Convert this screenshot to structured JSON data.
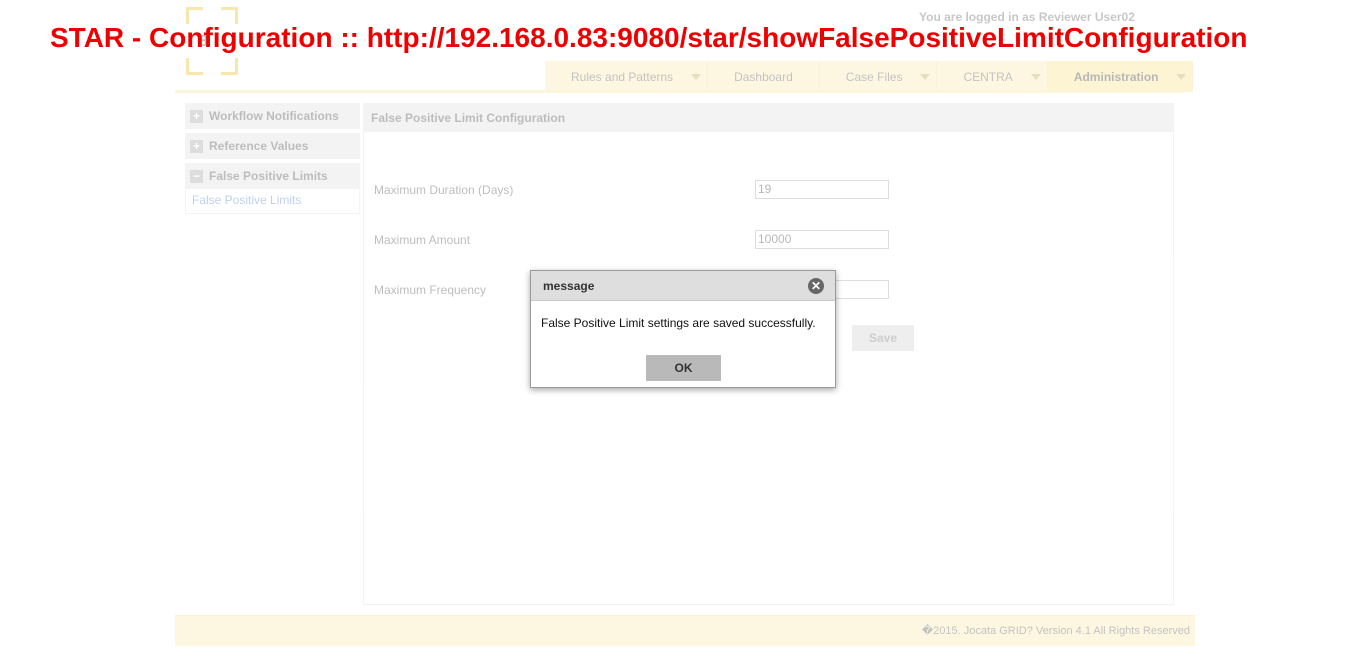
{
  "window_title": "STAR - Configuration :: http://192.168.0.83:9080/star/showFalsePositiveLimitConfiguration",
  "logo": {
    "mark": "8"
  },
  "header": {
    "login_text": "You are logged in as Reviewer User02"
  },
  "nav": {
    "items": [
      {
        "label": "Rules and Patterns",
        "has_caret": true
      },
      {
        "label": "Dashboard",
        "has_caret": false
      },
      {
        "label": "Case Files",
        "has_caret": true
      },
      {
        "label": "CENTRA",
        "has_caret": true
      },
      {
        "label": "Administration",
        "has_caret": true,
        "active": true
      }
    ]
  },
  "sidebar": {
    "sections": [
      {
        "label": "Workflow Notifications",
        "icon": "plus-icon",
        "sign": "+"
      },
      {
        "label": "Reference Values",
        "icon": "plus-icon",
        "sign": "+"
      },
      {
        "label": "False Positive Limits",
        "icon": "minus-icon",
        "sign": "−"
      }
    ],
    "link": "False Positive Limits"
  },
  "panel": {
    "title": "False Positive Limit Configuration",
    "fields": [
      {
        "label": "Maximum Duration (Days)",
        "value": "19"
      },
      {
        "label": "Maximum Amount",
        "value": "10000"
      },
      {
        "label": "Maximum Frequency",
        "value": ""
      }
    ],
    "save_label": "Save"
  },
  "footer": {
    "text": "�2015. Jocata GRID? Version 4.1 All Rights Reserved"
  },
  "dialog": {
    "title": "message",
    "message": "False Positive Limit settings are saved successfully.",
    "ok_label": "OK"
  },
  "colors": {
    "title_red": "#ee0000",
    "nav_bg": "#fbe9a3",
    "accent_yellow": "#e6b800"
  }
}
